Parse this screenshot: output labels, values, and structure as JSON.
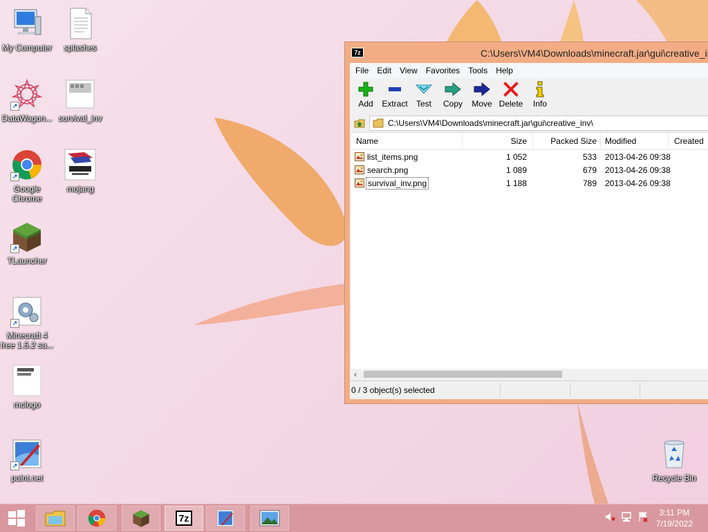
{
  "desktop": {
    "icons": [
      {
        "label": "My Computer",
        "icon": "computer-icon"
      },
      {
        "label": "splashes",
        "icon": "text-file-icon"
      },
      {
        "label": "DataWagon...",
        "icon": "datawagon-icon"
      },
      {
        "label": "survival_inv",
        "icon": "image-file-icon"
      },
      {
        "label": "Google Chrome",
        "icon": "chrome-icon"
      },
      {
        "label": "mojang",
        "icon": "mojang-image-icon"
      },
      {
        "label": "TLauncher",
        "icon": "minecraft-block-icon"
      },
      {
        "label": "Minecraft 4 free 1.5.2 sa...",
        "icon": "installer-icon"
      },
      {
        "label": "mclogo",
        "icon": "image-file-icon"
      },
      {
        "label": "paint.net",
        "icon": "paintnet-icon"
      },
      {
        "label": "Recycle Bin",
        "icon": "recycle-bin-icon"
      }
    ]
  },
  "window": {
    "app_badge": "7z",
    "title": "C:\\Users\\VM4\\Downloads\\minecraft.jar\\gui\\creative_inv\\",
    "menu": [
      "File",
      "Edit",
      "View",
      "Favorites",
      "Tools",
      "Help"
    ],
    "toolbar": [
      {
        "label": "Add",
        "icon": "plus-icon",
        "color": "#19b31b"
      },
      {
        "label": "Extract",
        "icon": "minus-icon",
        "color": "#1f3fb8"
      },
      {
        "label": "Test",
        "icon": "check-chevron-icon",
        "color": "#21a9c0"
      },
      {
        "label": "Copy",
        "icon": "copy-arrow-icon",
        "color": "#1e7f6c"
      },
      {
        "label": "Move",
        "icon": "move-arrow-icon",
        "color": "#1b2a9a"
      },
      {
        "label": "Delete",
        "icon": "x-icon",
        "color": "#e21d1d"
      },
      {
        "label": "Info",
        "icon": "info-icon",
        "color": "#e7c300"
      }
    ],
    "address": "C:\\Users\\VM4\\Downloads\\minecraft.jar\\gui\\creative_inv\\",
    "columns": [
      "Name",
      "Size",
      "Packed Size",
      "Modified",
      "Created"
    ],
    "files": [
      {
        "name": "list_items.png",
        "size": "1 052",
        "packed": "533",
        "modified": "2013-04-26 09:38",
        "created": ""
      },
      {
        "name": "search.png",
        "size": "1 089",
        "packed": "679",
        "modified": "2013-04-26 09:38",
        "created": ""
      },
      {
        "name": "survival_inv.png",
        "size": "1 188",
        "packed": "789",
        "modified": "2013-04-26 09:38",
        "created": ""
      }
    ],
    "status": "0 / 3 object(s) selected"
  },
  "taskbar": {
    "clock_time": "3:11 PM",
    "clock_date": "7/19/2022",
    "seven_zip_badge": "7z"
  },
  "colors": {
    "accent": "#f3ad85",
    "taskbar": "#d9989f"
  }
}
